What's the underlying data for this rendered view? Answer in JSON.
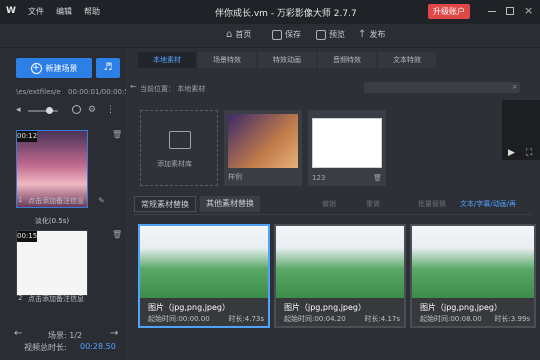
{
  "titlebar": {
    "logo": "W",
    "menu": [
      "文件",
      "编辑",
      "帮助"
    ],
    "title": "伴你成长.vm - 万彩影像大师 2.7.7",
    "upgrade": "升级账户"
  },
  "toolbar": {
    "home": "首页",
    "save": "保存",
    "preview": "预览",
    "publish": "发布"
  },
  "left": {
    "new_scene": "新建场景",
    "path": "\\es/extfiles/e",
    "timecode": "00:00:01/00:00:54",
    "scenes": [
      {
        "time": "00:12",
        "caption": "点击添加备注信息",
        "index": "1",
        "transition": "淡化(0.5s)"
      },
      {
        "time": "00:15",
        "caption": "点击添加备注信息",
        "index": "2"
      }
    ],
    "scene_count": "场景: 1/2",
    "total_label": "视频总时长:",
    "total_time": "00:28.50"
  },
  "main": {
    "tabs": [
      "本地素材",
      "场景特效",
      "特效动画",
      "音频特效",
      "文本特效"
    ],
    "current_pos_label": "当前位置：",
    "current_pos_value": "本地素材",
    "tiles": [
      {
        "label": "添加素材库"
      },
      {
        "label": "样例"
      },
      {
        "label": "123"
      }
    ],
    "subtabs": [
      "常规素材替换",
      "其他素材替换"
    ],
    "rtoolbar": [
      "撤销",
      "重做",
      "批量替换",
      "文本/字幕/动画/再"
    ],
    "clips": [
      {
        "title": "图片（jpg,png,jpeg）",
        "start": "起始时间:00:00.00",
        "dur": "时长:4.73s"
      },
      {
        "title": "图片（jpg,png,jpeg）",
        "start": "起始时间:00:04.20",
        "dur": "时长:4.17s"
      },
      {
        "title": "图片（jpg,png,jpeg）",
        "start": "起始时间:00:08.00",
        "dur": "时长:3.99s"
      }
    ]
  }
}
